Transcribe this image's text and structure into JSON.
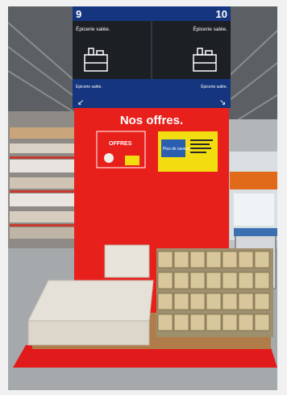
{
  "sign": {
    "left_aisle_number": "9",
    "right_aisle_number": "10",
    "left_aisle_name": "Épicerie salée.",
    "right_aisle_name": "Épicerie salée.",
    "left_small_label": "Épicerie salée.",
    "right_small_label": "Épicerie salée."
  },
  "promo_panel": {
    "headline": "Nos offres.",
    "left_poster_text": "OFFRES",
    "right_poster_text": "Plus de saveurs"
  },
  "colors": {
    "sign_blue": "#15357e",
    "promo_red": "#e8201c",
    "floor_red": "#e11b1b",
    "poster_yellow": "#f2dd10"
  }
}
